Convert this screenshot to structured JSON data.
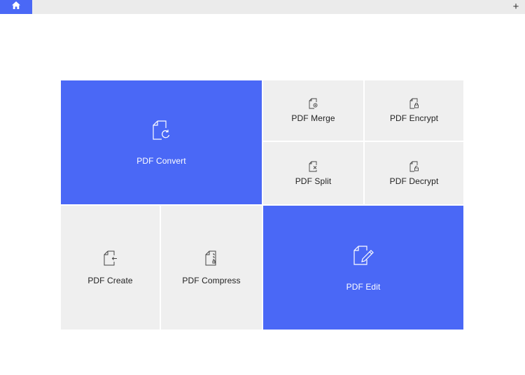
{
  "window": {
    "new_tab_label": "+"
  },
  "tiles": {
    "convert": {
      "label": "PDF Convert",
      "icon": "file-convert-icon"
    },
    "merge": {
      "label": "PDF Merge",
      "icon": "file-merge-icon"
    },
    "encrypt": {
      "label": "PDF Encrypt",
      "icon": "file-lock-icon"
    },
    "split": {
      "label": "PDF Split",
      "icon": "file-split-icon"
    },
    "decrypt": {
      "label": "PDF Decrypt",
      "icon": "file-unlock-icon"
    },
    "create": {
      "label": "PDF Create",
      "icon": "file-create-icon"
    },
    "compress": {
      "label": "PDF Compress",
      "icon": "file-zip-icon"
    },
    "edit": {
      "label": "PDF Edit",
      "icon": "file-edit-icon"
    }
  },
  "colors": {
    "accent": "#4a68f6",
    "tile_gray": "#efefef",
    "topbar": "#ebebeb"
  }
}
